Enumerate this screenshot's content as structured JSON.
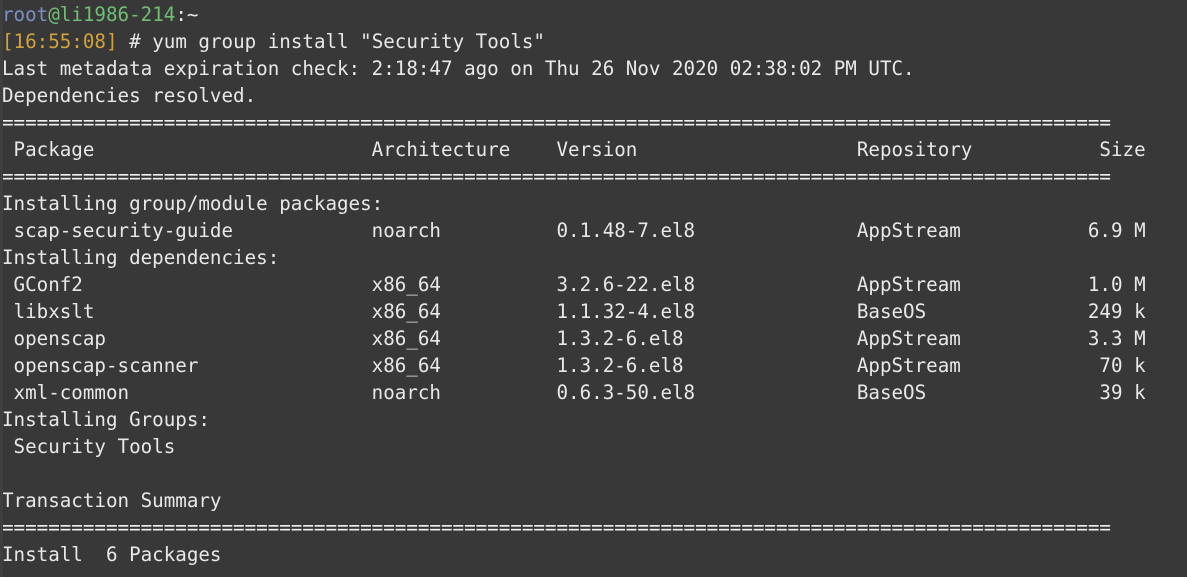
{
  "terminal": {
    "background_color": "#383838",
    "foreground_color": "#e8e8e8",
    "colors": {
      "user": "#7a8fc4",
      "host": "#6fbf73",
      "timestamp": "#d2a33b",
      "output": "#e8e8e8",
      "separator": "#f0f0f0"
    },
    "prompt": {
      "user": "root",
      "at": "@",
      "host": "li1986-214",
      "path": ":~",
      "timestamp": "[16:55:08]",
      "symbol": "#",
      "command": "yum group install \"Security Tools\""
    },
    "separator_line": "================================================================================================",
    "lines": {
      "metadata_check": "Last metadata expiration check: 2:18:47 ago on Thu 26 Nov 2020 02:38:02 PM UTC.",
      "dependencies_resolved": "Dependencies resolved.",
      "installing_group_header": "Installing group/module packages:",
      "installing_dependencies_header": "Installing dependencies:",
      "installing_groups_header": "Installing Groups:",
      "transaction_summary": "Transaction Summary",
      "install_count": "Install  6 Packages",
      "group_name": " Security Tools"
    },
    "table": {
      "columns": [
        "Package",
        "Architecture",
        "Version",
        "Repository",
        "Size"
      ],
      "header_row": " Package                        Architecture    Version                   Repository           Size",
      "rows": [
        {
          "package": "scap-security-guide",
          "architecture": "noarch",
          "version": "0.1.48-7.el8",
          "repository": "AppStream",
          "size": "6.9 M",
          "text": " scap-security-guide            noarch          0.1.48-7.el8              AppStream           6.9 M"
        },
        {
          "package": "GConf2",
          "architecture": "x86_64",
          "version": "3.2.6-22.el8",
          "repository": "AppStream",
          "size": "1.0 M",
          "text": " GConf2                         x86_64          3.2.6-22.el8              AppStream           1.0 M"
        },
        {
          "package": "libxslt",
          "architecture": "x86_64",
          "version": "1.1.32-4.el8",
          "repository": "BaseOS",
          "size": "249 k",
          "text": " libxslt                        x86_64          1.1.32-4.el8              BaseOS              249 k"
        },
        {
          "package": "openscap",
          "architecture": "x86_64",
          "version": "1.3.2-6.el8",
          "repository": "AppStream",
          "size": "3.3 M",
          "text": " openscap                       x86_64          1.3.2-6.el8               AppStream           3.3 M"
        },
        {
          "package": "openscap-scanner",
          "architecture": "x86_64",
          "version": "1.3.2-6.el8",
          "repository": "AppStream",
          "size": "70 k",
          "text": " openscap-scanner               x86_64          1.3.2-6.el8               AppStream            70 k"
        },
        {
          "package": "xml-common",
          "architecture": "noarch",
          "version": "0.6.3-50.el8",
          "repository": "BaseOS",
          "size": "39 k",
          "text": " xml-common                     noarch          0.6.3-50.el8              BaseOS               39 k"
        }
      ]
    }
  }
}
